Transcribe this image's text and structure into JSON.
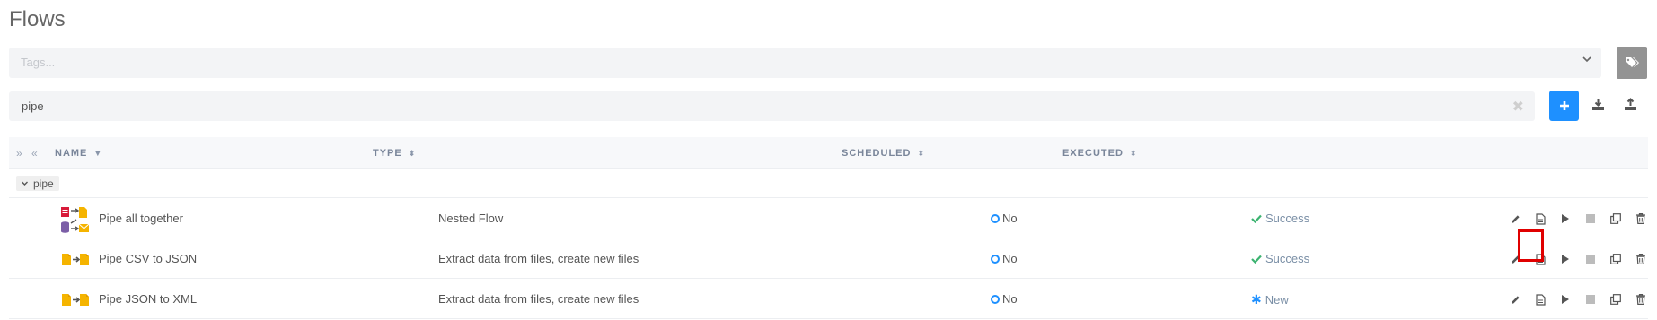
{
  "page": {
    "title": "Flows"
  },
  "tags": {
    "placeholder": "Tags..."
  },
  "search": {
    "value": "pipe"
  },
  "table": {
    "headers": {
      "name": "NAME",
      "type": "TYPE",
      "scheduled": "SCHEDULED",
      "executed": "EXECUTED"
    },
    "group": {
      "label": "pipe"
    },
    "rows": [
      {
        "name": "Pipe all together",
        "type": "Nested Flow",
        "scheduled": "No",
        "executed": "Success",
        "status": "success",
        "icon": "nested-flow-icon"
      },
      {
        "name": "Pipe CSV to JSON",
        "type": "Extract data from files, create new files",
        "scheduled": "No",
        "executed": "Success",
        "status": "success",
        "icon": "file-transfer-icon"
      },
      {
        "name": "Pipe JSON to XML",
        "type": "Extract data from files, create new files",
        "scheduled": "No",
        "executed": "New",
        "status": "new",
        "icon": "file-transfer-icon"
      }
    ]
  },
  "colors": {
    "accent": "#1e90ff",
    "success": "#3cb371",
    "highlight": "#e00000",
    "tag_button": "#939393"
  }
}
